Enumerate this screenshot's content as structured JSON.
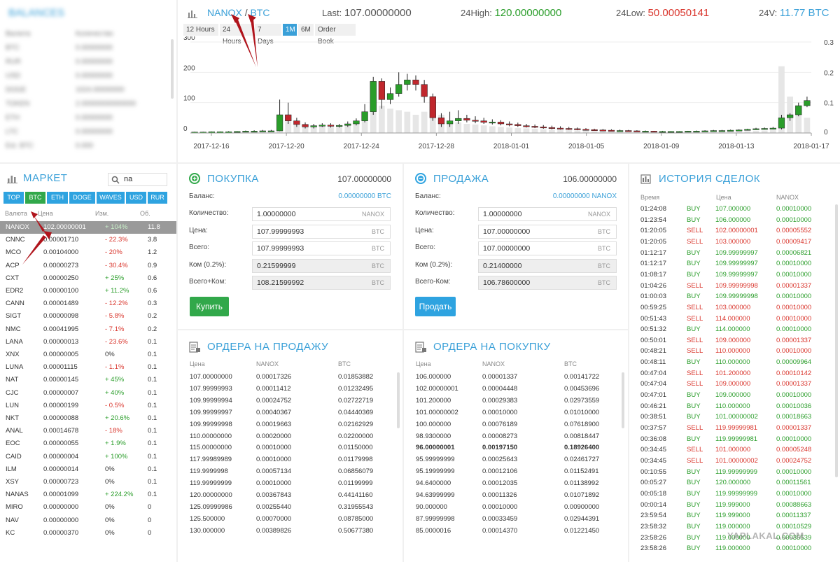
{
  "balances": {
    "title": "BALANCES",
    "header": [
      "Валюта",
      "Количество"
    ],
    "rows": [
      [
        "BTC",
        "0.00000000"
      ],
      [
        "RUR",
        "0.00000000"
      ],
      [
        "USD",
        "0.00000000"
      ],
      [
        "DOGE",
        "1024.00000000"
      ],
      [
        "TOKEN",
        "2.00000000000000"
      ],
      [
        "ETH",
        "0.00000000"
      ],
      [
        "LTC",
        "0.00000000"
      ],
      [
        "Est. BTC",
        "0.000"
      ]
    ]
  },
  "chart": {
    "pair_base": "NANOX",
    "pair_sep": "/",
    "pair_quote": "BTC",
    "last_label": "Last:",
    "last_value": "107.00000000",
    "high_label": "24High:",
    "high_value": "120.00000000",
    "low_label": "24Low:",
    "low_value": "50.00050141",
    "vol_label": "24V:",
    "vol_value": "11.77 BTC",
    "timeframes": [
      "12 Hours",
      "24 Hours",
      "7 Days",
      "1M",
      "6M",
      "Order Book"
    ],
    "active_timeframe": "1M"
  },
  "chart_data": {
    "type": "candlestick",
    "x_ticks": [
      "2017-12-16",
      "2017-12-20",
      "2017-12-24",
      "2017-12-28",
      "2018-01-01",
      "2018-01-05",
      "2018-01-09",
      "2018-01-13",
      "2018-01-17"
    ],
    "y_left_ticks": [
      "0",
      "100",
      "200",
      "300"
    ],
    "y_right_ticks": [
      "0",
      "0.1",
      "0.2",
      "0.3"
    ],
    "ylim": [
      0,
      300
    ],
    "y2lim": [
      0,
      0.3
    ],
    "candles": [
      {
        "o": 3,
        "c": 3,
        "h": 4,
        "l": 2,
        "v": 0.002
      },
      {
        "o": 3,
        "c": 3,
        "h": 4,
        "l": 2,
        "v": 0.002
      },
      {
        "o": 3,
        "c": 4,
        "h": 5,
        "l": 2,
        "v": 0.003
      },
      {
        "o": 4,
        "c": 4,
        "h": 5,
        "l": 3,
        "v": 0.002
      },
      {
        "o": 4,
        "c": 4,
        "h": 6,
        "l": 3,
        "v": 0.003
      },
      {
        "o": 4,
        "c": 5,
        "h": 6,
        "l": 3,
        "v": 0.003
      },
      {
        "o": 5,
        "c": 6,
        "h": 8,
        "l": 4,
        "v": 0.004
      },
      {
        "o": 6,
        "c": 6,
        "h": 9,
        "l": 5,
        "v": 0.004
      },
      {
        "o": 6,
        "c": 7,
        "h": 10,
        "l": 5,
        "v": 0.005
      },
      {
        "o": 7,
        "c": 7,
        "h": 10,
        "l": 6,
        "v": 0.005
      },
      {
        "o": 7,
        "c": 60,
        "h": 110,
        "l": 6,
        "v": 0.06
      },
      {
        "o": 60,
        "c": 40,
        "h": 100,
        "l": 30,
        "v": 0.045
      },
      {
        "o": 40,
        "c": 28,
        "h": 50,
        "l": 20,
        "v": 0.035
      },
      {
        "o": 28,
        "c": 20,
        "h": 35,
        "l": 15,
        "v": 0.03
      },
      {
        "o": 20,
        "c": 24,
        "h": 30,
        "l": 15,
        "v": 0.025
      },
      {
        "o": 24,
        "c": 26,
        "h": 32,
        "l": 20,
        "v": 0.022
      },
      {
        "o": 26,
        "c": 22,
        "h": 32,
        "l": 18,
        "v": 0.02
      },
      {
        "o": 22,
        "c": 25,
        "h": 30,
        "l": 18,
        "v": 0.02
      },
      {
        "o": 25,
        "c": 30,
        "h": 38,
        "l": 20,
        "v": 0.025
      },
      {
        "o": 30,
        "c": 40,
        "h": 48,
        "l": 25,
        "v": 0.035
      },
      {
        "o": 40,
        "c": 70,
        "h": 95,
        "l": 35,
        "v": 0.06
      },
      {
        "o": 70,
        "c": 170,
        "h": 185,
        "l": 60,
        "v": 0.11
      },
      {
        "o": 170,
        "c": 110,
        "h": 180,
        "l": 80,
        "v": 0.09
      },
      {
        "o": 110,
        "c": 130,
        "h": 150,
        "l": 95,
        "v": 0.08
      },
      {
        "o": 130,
        "c": 160,
        "h": 200,
        "l": 120,
        "v": 0.075
      },
      {
        "o": 160,
        "c": 175,
        "h": 195,
        "l": 140,
        "v": 0.07
      },
      {
        "o": 175,
        "c": 160,
        "h": 190,
        "l": 140,
        "v": 0.06
      },
      {
        "o": 160,
        "c": 120,
        "h": 175,
        "l": 100,
        "v": 0.07
      },
      {
        "o": 120,
        "c": 50,
        "h": 130,
        "l": 40,
        "v": 0.085
      },
      {
        "o": 50,
        "c": 30,
        "h": 65,
        "l": 20,
        "v": 0.06
      },
      {
        "o": 30,
        "c": 40,
        "h": 70,
        "l": 20,
        "v": 0.04
      },
      {
        "o": 40,
        "c": 48,
        "h": 75,
        "l": 30,
        "v": 0.035
      },
      {
        "o": 48,
        "c": 42,
        "h": 60,
        "l": 35,
        "v": 0.03
      },
      {
        "o": 42,
        "c": 40,
        "h": 55,
        "l": 32,
        "v": 0.028
      },
      {
        "o": 40,
        "c": 35,
        "h": 50,
        "l": 30,
        "v": 0.025
      },
      {
        "o": 35,
        "c": 36,
        "h": 45,
        "l": 28,
        "v": 0.022
      },
      {
        "o": 36,
        "c": 30,
        "h": 42,
        "l": 25,
        "v": 0.02
      },
      {
        "o": 30,
        "c": 28,
        "h": 38,
        "l": 22,
        "v": 0.018
      },
      {
        "o": 28,
        "c": 24,
        "h": 34,
        "l": 20,
        "v": 0.016
      },
      {
        "o": 24,
        "c": 22,
        "h": 30,
        "l": 18,
        "v": 0.015
      },
      {
        "o": 22,
        "c": 20,
        "h": 28,
        "l": 16,
        "v": 0.014
      },
      {
        "o": 20,
        "c": 18,
        "h": 26,
        "l": 14,
        "v": 0.012
      },
      {
        "o": 18,
        "c": 16,
        "h": 24,
        "l": 12,
        "v": 0.011
      },
      {
        "o": 16,
        "c": 15,
        "h": 22,
        "l": 11,
        "v": 0.01
      },
      {
        "o": 15,
        "c": 14,
        "h": 20,
        "l": 10,
        "v": 0.009
      },
      {
        "o": 14,
        "c": 12,
        "h": 18,
        "l": 9,
        "v": 0.008
      },
      {
        "o": 12,
        "c": 11,
        "h": 16,
        "l": 8,
        "v": 0.007
      },
      {
        "o": 11,
        "c": 10,
        "h": 14,
        "l": 7,
        "v": 0.006
      },
      {
        "o": 10,
        "c": 9,
        "h": 13,
        "l": 6,
        "v": 0.006
      },
      {
        "o": 9,
        "c": 8,
        "h": 12,
        "l": 6,
        "v": 0.005
      },
      {
        "o": 8,
        "c": 8,
        "h": 11,
        "l": 5,
        "v": 0.005
      },
      {
        "o": 8,
        "c": 7,
        "h": 10,
        "l": 5,
        "v": 0.004
      },
      {
        "o": 7,
        "c": 6,
        "h": 9,
        "l": 4,
        "v": 0.004
      },
      {
        "o": 6,
        "c": 6,
        "h": 8,
        "l": 4,
        "v": 0.003
      },
      {
        "o": 6,
        "c": 5,
        "h": 7,
        "l": 4,
        "v": 0.003
      },
      {
        "o": 5,
        "c": 5,
        "h": 7,
        "l": 3,
        "v": 0.003
      },
      {
        "o": 5,
        "c": 5,
        "h": 6,
        "l": 3,
        "v": 0.003
      },
      {
        "o": 5,
        "c": 5,
        "h": 6,
        "l": 3,
        "v": 0.002
      },
      {
        "o": 5,
        "c": 6,
        "h": 7,
        "l": 4,
        "v": 0.003
      },
      {
        "o": 6,
        "c": 6,
        "h": 8,
        "l": 4,
        "v": 0.003
      },
      {
        "o": 6,
        "c": 7,
        "h": 9,
        "l": 5,
        "v": 0.004
      },
      {
        "o": 7,
        "c": 8,
        "h": 10,
        "l": 5,
        "v": 0.004
      },
      {
        "o": 8,
        "c": 8,
        "h": 10,
        "l": 6,
        "v": 0.004
      },
      {
        "o": 8,
        "c": 9,
        "h": 11,
        "l": 6,
        "v": 0.005
      },
      {
        "o": 9,
        "c": 10,
        "h": 12,
        "l": 7,
        "v": 0.005
      },
      {
        "o": 10,
        "c": 12,
        "h": 14,
        "l": 8,
        "v": 0.006
      },
      {
        "o": 12,
        "c": 14,
        "h": 17,
        "l": 10,
        "v": 0.007
      },
      {
        "o": 14,
        "c": 15,
        "h": 18,
        "l": 11,
        "v": 0.008
      },
      {
        "o": 15,
        "c": 16,
        "h": 20,
        "l": 12,
        "v": 0.01
      },
      {
        "o": 16,
        "c": 50,
        "h": 60,
        "l": 12,
        "v": 0.22
      },
      {
        "o": 50,
        "c": 60,
        "h": 65,
        "l": 40,
        "v": 0.12
      },
      {
        "o": 60,
        "c": 90,
        "h": 100,
        "l": 55,
        "v": 0.08
      },
      {
        "o": 90,
        "c": 107,
        "h": 120,
        "l": 85,
        "v": 0.05
      }
    ]
  },
  "market": {
    "title": "МАРКЕТ",
    "search_value": "na",
    "tabs": [
      "TOP",
      "BTC",
      "ETH",
      "DOGE",
      "WAVES",
      "USD",
      "RUR"
    ],
    "active_tab": "BTC",
    "columns": [
      "Валюта",
      "Цена",
      "Изм.",
      "Об."
    ],
    "rows": [
      [
        "NANOX",
        "102.00000001",
        "+ 104%",
        "11.8"
      ],
      [
        "CNNC",
        "0.00001710",
        "- 22.3%",
        "3.8"
      ],
      [
        "MCO",
        "0.00104000",
        "- 20%",
        "1.2"
      ],
      [
        "ACP",
        "0.00000273",
        "- 30.4%",
        "0.9"
      ],
      [
        "CXT",
        "0.00000250",
        "+ 25%",
        "0.6"
      ],
      [
        "EDR2",
        "0.00000100",
        "+ 11.2%",
        "0.6"
      ],
      [
        "CANN",
        "0.00001489",
        "- 12.2%",
        "0.3"
      ],
      [
        "SIGT",
        "0.00000098",
        "- 5.8%",
        "0.2"
      ],
      [
        "NMC",
        "0.00041995",
        "- 7.1%",
        "0.2"
      ],
      [
        "LANA",
        "0.00000013",
        "- 23.6%",
        "0.1"
      ],
      [
        "XNX",
        "0.00000005",
        "0%",
        "0.1"
      ],
      [
        "LUNA",
        "0.00001115",
        "- 1.1%",
        "0.1"
      ],
      [
        "NAT",
        "0.00000145",
        "+ 45%",
        "0.1"
      ],
      [
        "CJC",
        "0.00000007",
        "+ 40%",
        "0.1"
      ],
      [
        "LUN",
        "0.00000199",
        "- 0.5%",
        "0.1"
      ],
      [
        "NKT",
        "0.00000088",
        "+ 20.6%",
        "0.1"
      ],
      [
        "ANAL",
        "0.00014678",
        "- 18%",
        "0.1"
      ],
      [
        "EOC",
        "0.00000055",
        "+ 1.9%",
        "0.1"
      ],
      [
        "CAID",
        "0.00000004",
        "+ 100%",
        "0.1"
      ],
      [
        "ILM",
        "0.00000014",
        "0%",
        "0.1"
      ],
      [
        "XSY",
        "0.00000723",
        "0%",
        "0.1"
      ],
      [
        "NANAS",
        "0.00001099",
        "+ 224.2%",
        "0.1"
      ],
      [
        "MIRO",
        "0.00000000",
        "0%",
        "0"
      ],
      [
        "NAV",
        "0.00000000",
        "0%",
        "0"
      ],
      [
        "KC",
        "0.00000370",
        "0%",
        "0"
      ]
    ]
  },
  "buy": {
    "title": "ПОКУПКА",
    "price": "107.00000000",
    "balance_label": "Баланс:",
    "balance_value": "0.00000000 BTC",
    "qty_label": "Количество:",
    "qty_value": "1.00000000",
    "qty_unit": "NANOX",
    "price_label": "Цена:",
    "price_value": "107.99999993",
    "price_unit": "BTC",
    "total_label": "Всего:",
    "total_value": "107.99999993",
    "total_unit": "BTC",
    "fee_label": "Ком (0.2%):",
    "fee_value": "0.21599999",
    "fee_unit": "BTC",
    "grand_label": "Всего+Ком:",
    "grand_value": "108.21599992",
    "grand_unit": "BTC",
    "button": "Купить"
  },
  "sell": {
    "title": "ПРОДАЖА",
    "price": "106.00000000",
    "balance_label": "Баланс:",
    "balance_value": "0.00000000 NANOX",
    "qty_label": "Количество:",
    "qty_value": "1.00000000",
    "qty_unit": "NANOX",
    "price_label": "Цена:",
    "price_value": "107.00000000",
    "price_unit": "BTC",
    "total_label": "Всего:",
    "total_value": "107.00000000",
    "total_unit": "BTC",
    "fee_label": "Ком (0.2%):",
    "fee_value": "0.21400000",
    "fee_unit": "BTC",
    "grand_label": "Всего-Ком:",
    "grand_value": "106.78600000",
    "grand_unit": "BTC",
    "button": "Продать"
  },
  "sell_orders": {
    "title": "ОРДЕРА НА ПРОДАЖУ",
    "columns": [
      "Цена",
      "NANOX",
      "BTC"
    ],
    "rows": [
      [
        "107.00000000",
        "0.00017326",
        "0.01853882"
      ],
      [
        "107.99999993",
        "0.00011412",
        "0.01232495"
      ],
      [
        "109.99999994",
        "0.00024752",
        "0.02722719"
      ],
      [
        "109.99999997",
        "0.00040367",
        "0.04440369"
      ],
      [
        "109.99999998",
        "0.00019663",
        "0.02162929"
      ],
      [
        "110.00000000",
        "0.00020000",
        "0.02200000"
      ],
      [
        "115.00000000",
        "0.00010000",
        "0.01150000"
      ],
      [
        "117.99989989",
        "0.00010000",
        "0.01179998"
      ],
      [
        "119.9999998",
        "0.00057134",
        "0.06856079"
      ],
      [
        "119.99999999",
        "0.00010000",
        "0.01199999"
      ],
      [
        "120.00000000",
        "0.00367843",
        "0.44141160"
      ],
      [
        "125.09999986",
        "0.00255440",
        "0.31955543"
      ],
      [
        "125.500000",
        "0.00070000",
        "0.08785000"
      ],
      [
        "130.000000",
        "0.00389826",
        "0.50677380"
      ]
    ]
  },
  "buy_orders": {
    "title": "ОРДЕРА НА ПОКУПКУ",
    "columns": [
      "Цена",
      "NANOX",
      "BTC"
    ],
    "rows": [
      [
        "106.000000",
        "0.00001337",
        "0.00141722"
      ],
      [
        "102.00000001",
        "0.00004448",
        "0.00453696"
      ],
      [
        "101.200000",
        "0.00029383",
        "0.02973559"
      ],
      [
        "101.00000002",
        "0.00010000",
        "0.01010000"
      ],
      [
        "100.000000",
        "0.00076189",
        "0.07618900"
      ],
      [
        "98.9300000",
        "0.00008273",
        "0.00818447"
      ],
      [
        "96.00000001",
        "0.00197150",
        "0.18926400"
      ],
      [
        "95.99999999",
        "0.00025643",
        "0.02461727"
      ],
      [
        "95.19999999",
        "0.00012106",
        "0.01152491"
      ],
      [
        "94.6400000",
        "0.00012035",
        "0.01138992"
      ],
      [
        "94.63999999",
        "0.00011326",
        "0.01071892"
      ],
      [
        "90.000000",
        "0.00010000",
        "0.00900000"
      ],
      [
        "87.99999998",
        "0.00033459",
        "0.02944391"
      ],
      [
        "85.0000016",
        "0.00014370",
        "0.01221450"
      ]
    ],
    "bold_row": 6
  },
  "history": {
    "title": "ИСТОРИЯ СДЕЛОК",
    "columns": [
      "Время",
      "Цена",
      "NANOX"
    ],
    "rows": [
      [
        "01:24:08",
        "BUY",
        "107.000000",
        "0.00010000"
      ],
      [
        "01:23:54",
        "BUY",
        "106.000000",
        "0.00010000"
      ],
      [
        "01:20:05",
        "SELL",
        "102.00000001",
        "0.00005552"
      ],
      [
        "01:20:05",
        "SELL",
        "103.000000",
        "0.00009417"
      ],
      [
        "01:12:17",
        "BUY",
        "109.99999997",
        "0.00006821"
      ],
      [
        "01:12:17",
        "BUY",
        "109.99999997",
        "0.00010000"
      ],
      [
        "01:08:17",
        "BUY",
        "109.99999997",
        "0.00010000"
      ],
      [
        "01:04:26",
        "SELL",
        "109.99999998",
        "0.00001337"
      ],
      [
        "01:00:03",
        "BUY",
        "109.99999998",
        "0.00010000"
      ],
      [
        "00:59:25",
        "SELL",
        "103.000000",
        "0.00010000"
      ],
      [
        "00:51:43",
        "SELL",
        "114.000000",
        "0.00010000"
      ],
      [
        "00:51:32",
        "BUY",
        "114.000000",
        "0.00010000"
      ],
      [
        "00:50:01",
        "SELL",
        "109.000000",
        "0.00001337"
      ],
      [
        "00:48:21",
        "SELL",
        "110.000000",
        "0.00010000"
      ],
      [
        "00:48:11",
        "BUY",
        "110.000000",
        "0.00009964"
      ],
      [
        "00:47:04",
        "SELL",
        "101.200000",
        "0.00010142"
      ],
      [
        "00:47:04",
        "SELL",
        "109.000000",
        "0.00001337"
      ],
      [
        "00:47:01",
        "BUY",
        "109.000000",
        "0.00010000"
      ],
      [
        "00:46:21",
        "BUY",
        "110.000000",
        "0.00010036"
      ],
      [
        "00:38:51",
        "BUY",
        "101.00000002",
        "0.00018663"
      ],
      [
        "00:37:57",
        "SELL",
        "119.99999981",
        "0.00001337"
      ],
      [
        "00:36:08",
        "BUY",
        "119.99999981",
        "0.00010000"
      ],
      [
        "00:34:45",
        "SELL",
        "101.000000",
        "0.00005248"
      ],
      [
        "00:34:45",
        "SELL",
        "101.00000002",
        "0.00024752"
      ],
      [
        "00:10:55",
        "BUY",
        "119.99999999",
        "0.00010000"
      ],
      [
        "00:05:27",
        "BUY",
        "120.000000",
        "0.00011561"
      ],
      [
        "00:05:18",
        "BUY",
        "119.99999999",
        "0.00010000"
      ],
      [
        "00:00:14",
        "BUY",
        "119.999000",
        "0.00088663"
      ],
      [
        "23:59:54",
        "BUY",
        "119.999000",
        "0.00011337"
      ],
      [
        "23:58:32",
        "BUY",
        "119.000000",
        "0.00010529"
      ],
      [
        "23:58:26",
        "BUY",
        "119.000000",
        "0.00035539"
      ],
      [
        "23:58:26",
        "BUY",
        "119.000000",
        "0.00010000"
      ]
    ]
  },
  "watermark": "YAPLAKAL.COM",
  "colors": {
    "accent": "#3aa0d8",
    "buy": "#31a84a",
    "sell": "#d9342b",
    "selected_row": "#9a9a9a",
    "annotation": "#b0141c"
  }
}
